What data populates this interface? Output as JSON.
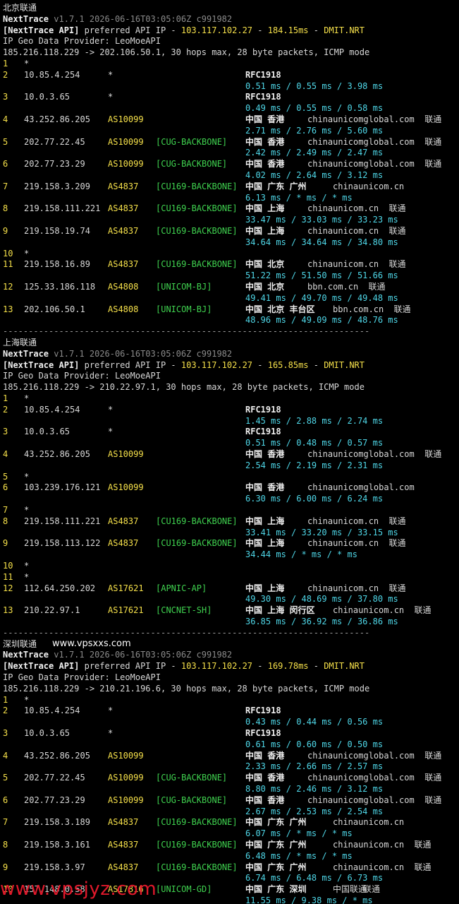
{
  "sections": [
    {
      "title": "北京联通",
      "tool": "NextTrace",
      "version": "v1.7.1 2026-06-16T03:05:06Z c991982",
      "api_line": {
        "prefix": "[NextTrace API]",
        "text": " preferred API IP - ",
        "ip": "103.117.102.27",
        "dash": " - ",
        "ms": "184.15ms",
        "dash2": " - ",
        "node": "DMIT.NRT"
      },
      "geo_provider": "IP Geo Data Provider: LeoMoeAPI",
      "trace_line": "185.216.118.229 -> 202.106.50.1, 30 hops max, 28 byte packets, ICMP mode",
      "hops": [
        {
          "n": "1",
          "ip": "*",
          "as": "",
          "tag": "",
          "geo": "",
          "host": "",
          "isp": "",
          "lat": ""
        },
        {
          "n": "2",
          "ip": "10.85.4.254",
          "as": "*",
          "tag": "",
          "geo": "RFC1918",
          "host": "",
          "isp": "",
          "lat": "0.51 ms / 0.55 ms / 3.98 ms"
        },
        {
          "n": "3",
          "ip": "10.0.3.65",
          "as": "*",
          "tag": "",
          "geo": "RFC1918",
          "host": "",
          "isp": "",
          "lat": "0.49 ms / 0.55 ms / 0.58 ms"
        },
        {
          "n": "4",
          "ip": "43.252.86.205",
          "as": "AS10099",
          "tag": "",
          "geo": "中国 香港",
          "host": "chinaunicomglobal.com",
          "isp": "联通",
          "lat": "2.71 ms / 2.76 ms / 5.60 ms"
        },
        {
          "n": "5",
          "ip": "202.77.22.45",
          "as": "AS10099",
          "tag": "[CUG-BACKBONE]",
          "geo": "中国 香港",
          "host": "chinaunicomglobal.com",
          "isp": "联通",
          "lat": "2.42 ms / 2.49 ms / 2.47 ms"
        },
        {
          "n": "6",
          "ip": "202.77.23.29",
          "as": "AS10099",
          "tag": "[CUG-BACKBONE]",
          "geo": "中国 香港",
          "host": "chinaunicomglobal.com",
          "isp": "联通",
          "lat": "4.02 ms / 2.64 ms / 3.12 ms"
        },
        {
          "n": "7",
          "ip": "219.158.3.209",
          "as": "AS4837",
          "tag": "[CU169-BACKBONE]",
          "geo": "中国 广东 广州",
          "host": "chinaunicom.cn",
          "isp": "",
          "lat": "6.13 ms / * ms / * ms"
        },
        {
          "n": "8",
          "ip": "219.158.111.221",
          "as": "AS4837",
          "tag": "[CU169-BACKBONE]",
          "geo": "中国 上海",
          "host": "chinaunicom.cn",
          "isp": "联通",
          "lat": "33.47 ms / 33.03 ms / 33.23 ms"
        },
        {
          "n": "9",
          "ip": "219.158.19.74",
          "as": "AS4837",
          "tag": "[CU169-BACKBONE]",
          "geo": "中国 上海",
          "host": "chinaunicom.cn",
          "isp": "联通",
          "lat": "34.64 ms / 34.64 ms / 34.80 ms"
        },
        {
          "n": "10",
          "ip": "*",
          "as": "",
          "tag": "",
          "geo": "",
          "host": "",
          "isp": "",
          "lat": ""
        },
        {
          "n": "11",
          "ip": "219.158.16.89",
          "as": "AS4837",
          "tag": "[CU169-BACKBONE]",
          "geo": "中国 北京",
          "host": "chinaunicom.cn",
          "isp": "联通",
          "lat": "51.22 ms / 51.50 ms / 51.66 ms"
        },
        {
          "n": "12",
          "ip": "125.33.186.118",
          "as": "AS4808",
          "tag": "[UNICOM-BJ]",
          "geo": "中国 北京",
          "host": "bbn.com.cn",
          "isp": "联通",
          "lat": "49.41 ms / 49.70 ms / 49.48 ms"
        },
        {
          "n": "13",
          "ip": "202.106.50.1",
          "as": "AS4808",
          "tag": "[UNICOM-BJ]",
          "geo": "中国 北京 丰台区",
          "host": "bbn.com.cn",
          "isp": "联通",
          "lat": "48.96 ms / 49.09 ms / 48.76 ms"
        }
      ]
    },
    {
      "title": "上海联通",
      "tool": "NextTrace",
      "version": "v1.7.1 2026-06-16T03:05:06Z c991982",
      "api_line": {
        "prefix": "[NextTrace API]",
        "text": " preferred API IP - ",
        "ip": "103.117.102.27",
        "dash": " - ",
        "ms": "165.85ms",
        "dash2": " - ",
        "node": "DMIT.NRT"
      },
      "geo_provider": "IP Geo Data Provider: LeoMoeAPI",
      "trace_line": "185.216.118.229 -> 210.22.97.1, 30 hops max, 28 byte packets, ICMP mode",
      "hops": [
        {
          "n": "1",
          "ip": "*",
          "as": "",
          "tag": "",
          "geo": "",
          "host": "",
          "isp": "",
          "lat": ""
        },
        {
          "n": "2",
          "ip": "10.85.4.254",
          "as": "*",
          "tag": "",
          "geo": "RFC1918",
          "host": "",
          "isp": "",
          "lat": "1.45 ms / 2.88 ms / 2.74 ms"
        },
        {
          "n": "3",
          "ip": "10.0.3.65",
          "as": "*",
          "tag": "",
          "geo": "RFC1918",
          "host": "",
          "isp": "",
          "lat": "0.51 ms / 0.48 ms / 0.57 ms"
        },
        {
          "n": "4",
          "ip": "43.252.86.205",
          "as": "AS10099",
          "tag": "",
          "geo": "中国 香港",
          "host": "chinaunicomglobal.com",
          "isp": "联通",
          "lat": "2.54 ms / 2.19 ms / 2.31 ms"
        },
        {
          "n": "5",
          "ip": "*",
          "as": "",
          "tag": "",
          "geo": "",
          "host": "",
          "isp": "",
          "lat": ""
        },
        {
          "n": "6",
          "ip": "103.239.176.121",
          "as": "AS10099",
          "tag": "",
          "geo": "中国 香港",
          "host": "chinaunicomglobal.com",
          "isp": "",
          "lat": "6.30 ms / 6.00 ms / 6.24 ms"
        },
        {
          "n": "7",
          "ip": "*",
          "as": "",
          "tag": "",
          "geo": "",
          "host": "",
          "isp": "",
          "lat": ""
        },
        {
          "n": "8",
          "ip": "219.158.111.221",
          "as": "AS4837",
          "tag": "[CU169-BACKBONE]",
          "geo": "中国 上海",
          "host": "chinaunicom.cn",
          "isp": "联通",
          "lat": "33.41 ms / 33.20 ms / 33.15 ms"
        },
        {
          "n": "9",
          "ip": "219.158.113.122",
          "as": "AS4837",
          "tag": "[CU169-BACKBONE]",
          "geo": "中国 上海",
          "host": "chinaunicom.cn",
          "isp": "联通",
          "lat": "34.44 ms / * ms / * ms"
        },
        {
          "n": "10",
          "ip": "*",
          "as": "",
          "tag": "",
          "geo": "",
          "host": "",
          "isp": "",
          "lat": ""
        },
        {
          "n": "11",
          "ip": "*",
          "as": "",
          "tag": "",
          "geo": "",
          "host": "",
          "isp": "",
          "lat": ""
        },
        {
          "n": "12",
          "ip": "112.64.250.202",
          "as": "AS17621",
          "tag": "[APNIC-AP]",
          "geo": "中国 上海",
          "host": "chinaunicom.cn",
          "isp": "联通",
          "lat": "49.30 ms / 48.69 ms / 37.80 ms"
        },
        {
          "n": "13",
          "ip": "210.22.97.1",
          "as": "AS17621",
          "tag": "[CNCNET-SH]",
          "geo": "中国 上海 闵行区",
          "host": "chinaunicom.cn",
          "isp": "联通",
          "lat": "36.85 ms / 36.92 ms / 36.86 ms"
        }
      ]
    },
    {
      "title": "深圳联通",
      "site_label": "www.vpsxxs.com",
      "tool": "NextTrace",
      "version": "v1.7.1 2026-06-16T03:05:06Z c991982",
      "api_line": {
        "prefix": "[NextTrace API]",
        "text": " preferred API IP - ",
        "ip": "103.117.102.27",
        "dash": " - ",
        "ms": "169.78ms",
        "dash2": " - ",
        "node": "DMIT.NRT"
      },
      "geo_provider": "IP Geo Data Provider: LeoMoeAPI",
      "trace_line": "185.216.118.229 -> 210.21.196.6, 30 hops max, 28 byte packets, ICMP mode",
      "hops": [
        {
          "n": "1",
          "ip": "*",
          "as": "",
          "tag": "",
          "geo": "",
          "host": "",
          "isp": "",
          "lat": ""
        },
        {
          "n": "2",
          "ip": "10.85.4.254",
          "as": "*",
          "tag": "",
          "geo": "RFC1918",
          "host": "",
          "isp": "",
          "lat": "0.43 ms / 0.44 ms / 0.56 ms"
        },
        {
          "n": "3",
          "ip": "10.0.3.65",
          "as": "*",
          "tag": "",
          "geo": "RFC1918",
          "host": "",
          "isp": "",
          "lat": "0.61 ms / 0.60 ms / 0.50 ms"
        },
        {
          "n": "4",
          "ip": "43.252.86.205",
          "as": "AS10099",
          "tag": "",
          "geo": "中国 香港",
          "host": "chinaunicomglobal.com",
          "isp": "联通",
          "lat": "2.33 ms / 2.66 ms / 2.57 ms"
        },
        {
          "n": "5",
          "ip": "202.77.22.45",
          "as": "AS10099",
          "tag": "[CUG-BACKBONE]",
          "geo": "中国 香港",
          "host": "chinaunicomglobal.com",
          "isp": "联通",
          "lat": "8.80 ms / 2.46 ms / 3.12 ms"
        },
        {
          "n": "6",
          "ip": "202.77.23.29",
          "as": "AS10099",
          "tag": "[CUG-BACKBONE]",
          "geo": "中国 香港",
          "host": "chinaunicomglobal.com",
          "isp": "联通",
          "lat": "2.67 ms / 2.53 ms / 2.54 ms"
        },
        {
          "n": "7",
          "ip": "219.158.3.189",
          "as": "AS4837",
          "tag": "[CU169-BACKBONE]",
          "geo": "中国 广东 广州",
          "host": "chinaunicom.cn",
          "isp": "",
          "lat": "6.07 ms / * ms / * ms"
        },
        {
          "n": "8",
          "ip": "219.158.3.161",
          "as": "AS4837",
          "tag": "[CU169-BACKBONE]",
          "geo": "中国 广东 广州",
          "host": "chinaunicom.cn",
          "isp": "联通",
          "lat": "6.48 ms / * ms / * ms"
        },
        {
          "n": "9",
          "ip": "219.158.3.97",
          "as": "AS4837",
          "tag": "[CU169-BACKBONE]",
          "geo": "中国 广东 广州",
          "host": "chinaunicom.cn",
          "isp": "联通",
          "lat": "6.74 ms / 6.48 ms / 6.73 ms"
        },
        {
          "n": "10",
          "ip": "157.148.0.58",
          "as": "AS17816",
          "tag": "[UNICOM-GD]",
          "geo": "中国 广东 深圳",
          "host": "中国联通",
          "isp": "联通",
          "lat": "11.55 ms / 9.38 ms / * ms"
        }
      ]
    }
  ],
  "separator": "------------------------------------------------------------------------",
  "watermark": "www.vpsjyz.com",
  "colors": {
    "hop_number": "#f5e04a",
    "as_number": "#f5e04a",
    "backbone_tag": "#3fd24f",
    "latency": "#4fd7e8",
    "api_ip": "#f5e04a",
    "watermark": "#e0192b"
  }
}
